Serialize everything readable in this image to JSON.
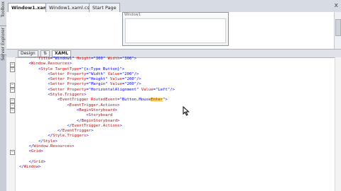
{
  "left_toolbox": {
    "items": [
      "Toolbox",
      "Server Explorer"
    ]
  },
  "doc_tabs": [
    {
      "label": "Window1.xaml",
      "active": true
    },
    {
      "label": "Window1.xaml.cs",
      "active": false
    },
    {
      "label": "Start Page",
      "active": false
    }
  ],
  "close_label": "x",
  "designer": {
    "window_title": "Window1"
  },
  "view_buttons": [
    {
      "label": "Design",
      "active": false
    },
    {
      "label": "⇅",
      "active": false
    },
    {
      "label": "XAML",
      "active": true
    }
  ],
  "code_lines": [
    [
      {
        "t": "        ",
        "c": "txt"
      },
      {
        "t": "Title",
        "c": "attr"
      },
      {
        "t": "=\"Window1\" ",
        "c": "val"
      },
      {
        "t": "Height",
        "c": "attr"
      },
      {
        "t": "=\"300\" ",
        "c": "val"
      },
      {
        "t": "Width",
        "c": "attr"
      },
      {
        "t": "=\"300\">",
        "c": "val"
      }
    ],
    [
      {
        "t": "    ",
        "c": "txt"
      },
      {
        "t": "<",
        "c": "punc"
      },
      {
        "t": "Window.Resources",
        "c": "tag"
      },
      {
        "t": ">",
        "c": "punc"
      }
    ],
    [
      {
        "t": "        ",
        "c": "txt"
      },
      {
        "t": "<",
        "c": "punc"
      },
      {
        "t": "Style",
        "c": "tag"
      },
      {
        "t": " TargetType",
        "c": "attr"
      },
      {
        "t": "=\"{x:Type Button}\">",
        "c": "val"
      }
    ],
    [
      {
        "t": "            ",
        "c": "txt"
      },
      {
        "t": "<",
        "c": "punc"
      },
      {
        "t": "Setter",
        "c": "tag"
      },
      {
        "t": " Property",
        "c": "attr"
      },
      {
        "t": "=\"Width\" ",
        "c": "val"
      },
      {
        "t": "Value",
        "c": "attr"
      },
      {
        "t": "=\"200\"/>",
        "c": "val"
      }
    ],
    [
      {
        "t": "            ",
        "c": "txt"
      },
      {
        "t": "<",
        "c": "punc"
      },
      {
        "t": "Setter",
        "c": "tag"
      },
      {
        "t": " Property",
        "c": "attr"
      },
      {
        "t": "=\"Height\" ",
        "c": "val"
      },
      {
        "t": "Value",
        "c": "attr"
      },
      {
        "t": "=\"200\"/>",
        "c": "val"
      }
    ],
    [
      {
        "t": "            ",
        "c": "txt"
      },
      {
        "t": "<",
        "c": "punc"
      },
      {
        "t": "Setter",
        "c": "tag"
      },
      {
        "t": " Property",
        "c": "attr"
      },
      {
        "t": "=\"Margin\" ",
        "c": "val"
      },
      {
        "t": "Value",
        "c": "attr"
      },
      {
        "t": "=\"200\"/>",
        "c": "val"
      }
    ],
    [
      {
        "t": "            ",
        "c": "txt"
      },
      {
        "t": "<",
        "c": "punc"
      },
      {
        "t": "Setter",
        "c": "tag"
      },
      {
        "t": " Property",
        "c": "attr"
      },
      {
        "t": "=\"HorizontalAlignment\" ",
        "c": "val"
      },
      {
        "t": "Value",
        "c": "attr"
      },
      {
        "t": "=\"Left\"/>",
        "c": "val"
      }
    ],
    [
      {
        "t": "            ",
        "c": "txt"
      },
      {
        "t": "<",
        "c": "punc"
      },
      {
        "t": "Style.Triggers",
        "c": "tag"
      },
      {
        "t": ">",
        "c": "punc"
      }
    ],
    [
      {
        "t": "                ",
        "c": "txt"
      },
      {
        "t": "<",
        "c": "punc"
      },
      {
        "t": "EventTrigger",
        "c": "tag"
      },
      {
        "t": " RoutedEvent",
        "c": "attr"
      },
      {
        "t": "=\"Button.Mouse",
        "c": "val"
      },
      {
        "t": "Enter",
        "c": "hl"
      },
      {
        "t": "\">",
        "c": "val"
      }
    ],
    [
      {
        "t": "                    ",
        "c": "txt"
      },
      {
        "t": "<",
        "c": "punc"
      },
      {
        "t": "EventTrigger.Actions",
        "c": "tag"
      },
      {
        "t": ">",
        "c": "punc"
      }
    ],
    [
      {
        "t": "                        ",
        "c": "txt"
      },
      {
        "t": "<",
        "c": "punc"
      },
      {
        "t": "BeginStoryboard",
        "c": "tag"
      },
      {
        "t": ">",
        "c": "punc"
      }
    ],
    [
      {
        "t": "                            ",
        "c": "txt"
      },
      {
        "t": "<",
        "c": "punc"
      },
      {
        "t": "Storyboard",
        "c": "tag"
      }
    ],
    [
      {
        "t": "                        ",
        "c": "txt"
      },
      {
        "t": "</",
        "c": "punc"
      },
      {
        "t": "BeginStoryboard",
        "c": "tag"
      },
      {
        "t": ">",
        "c": "punc"
      }
    ],
    [
      {
        "t": "                    ",
        "c": "txt"
      },
      {
        "t": "</",
        "c": "punc"
      },
      {
        "t": "EventTrigger.Actions",
        "c": "tag"
      },
      {
        "t": ">",
        "c": "punc"
      }
    ],
    [
      {
        "t": "                ",
        "c": "txt"
      },
      {
        "t": "</",
        "c": "punc"
      },
      {
        "t": "EventTrigger",
        "c": "tag"
      },
      {
        "t": ">",
        "c": "punc"
      }
    ],
    [
      {
        "t": "            ",
        "c": "txt"
      },
      {
        "t": "</",
        "c": "punc"
      },
      {
        "t": "Style.Triggers",
        "c": "tag"
      },
      {
        "t": ">",
        "c": "punc"
      }
    ],
    [
      {
        "t": "        ",
        "c": "txt"
      },
      {
        "t": "</",
        "c": "punc"
      },
      {
        "t": "Style",
        "c": "tag"
      },
      {
        "t": ">",
        "c": "punc"
      }
    ],
    [
      {
        "t": "    ",
        "c": "txt"
      },
      {
        "t": "</",
        "c": "punc"
      },
      {
        "t": "Window.Resources",
        "c": "tag"
      },
      {
        "t": ">",
        "c": "punc"
      }
    ],
    [
      {
        "t": "    ",
        "c": "txt"
      },
      {
        "t": "<",
        "c": "punc"
      },
      {
        "t": "Grid",
        "c": "tag"
      },
      {
        "t": ">",
        "c": "punc"
      }
    ],
    [
      {
        "t": "",
        "c": "txt"
      }
    ],
    [
      {
        "t": "    ",
        "c": "txt"
      },
      {
        "t": "</",
        "c": "punc"
      },
      {
        "t": "Grid",
        "c": "tag"
      },
      {
        "t": ">",
        "c": "punc"
      }
    ],
    [
      {
        "t": "</",
        "c": "punc"
      },
      {
        "t": "Window",
        "c": "tag"
      },
      {
        "t": ">",
        "c": "punc"
      }
    ]
  ],
  "colors": {
    "tag": "#a31515",
    "attribute": "#e00000",
    "value": "#0000ff",
    "highlight": "#ffe36a"
  }
}
